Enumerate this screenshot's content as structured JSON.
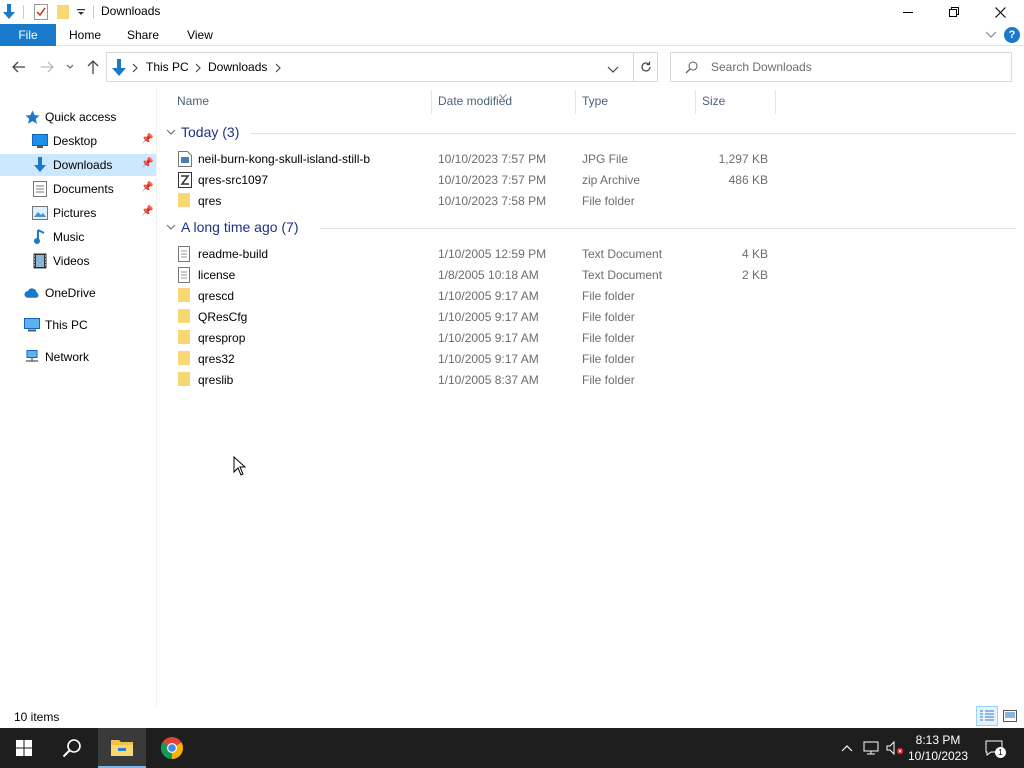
{
  "window": {
    "title": "Downloads",
    "controls": {
      "minimize": "minimize",
      "restore": "restore",
      "close": "close"
    }
  },
  "ribbon": {
    "tabs": [
      "File",
      "Home",
      "Share",
      "View"
    ],
    "help": "?"
  },
  "address": {
    "crumbs": [
      "This PC",
      "Downloads"
    ],
    "search_placeholder": "Search Downloads"
  },
  "navpane": {
    "items": [
      {
        "label": "Quick access",
        "icon": "star-icon"
      },
      {
        "label": "Desktop",
        "icon": "desktop-icon",
        "pinned": true
      },
      {
        "label": "Downloads",
        "icon": "download-icon",
        "pinned": true,
        "selected": true
      },
      {
        "label": "Documents",
        "icon": "documents-icon",
        "pinned": true
      },
      {
        "label": "Pictures",
        "icon": "pictures-icon",
        "pinned": true
      },
      {
        "label": "Music",
        "icon": "music-icon"
      },
      {
        "label": "Videos",
        "icon": "videos-icon"
      },
      {
        "label": "OneDrive",
        "icon": "cloud-icon"
      },
      {
        "label": "This PC",
        "icon": "computer-icon"
      },
      {
        "label": "Network",
        "icon": "network-icon"
      }
    ]
  },
  "columns": {
    "name": "Name",
    "date": "Date modified",
    "type": "Type",
    "size": "Size"
  },
  "groups": [
    {
      "label": "Today (3)",
      "files": [
        {
          "name": "neil-burn-kong-skull-island-still-b",
          "date": "10/10/2023 7:57 PM",
          "type": "JPG File",
          "size": "1,297 KB",
          "icon": "image-file-icon"
        },
        {
          "name": "qres-src1097",
          "date": "10/10/2023 7:57 PM",
          "type": "zip Archive",
          "size": "486 KB",
          "icon": "zip-file-icon"
        },
        {
          "name": "qres",
          "date": "10/10/2023 7:58 PM",
          "type": "File folder",
          "size": "",
          "icon": "folder-icon"
        }
      ]
    },
    {
      "label": "A long time ago (7)",
      "files": [
        {
          "name": "readme-build",
          "date": "1/10/2005 12:59 PM",
          "type": "Text Document",
          "size": "4 KB",
          "icon": "text-file-icon"
        },
        {
          "name": "license",
          "date": "1/8/2005 10:18 AM",
          "type": "Text Document",
          "size": "2 KB",
          "icon": "text-file-icon"
        },
        {
          "name": "qrescd",
          "date": "1/10/2005 9:17 AM",
          "type": "File folder",
          "size": "",
          "icon": "folder-icon"
        },
        {
          "name": "QResCfg",
          "date": "1/10/2005 9:17 AM",
          "type": "File folder",
          "size": "",
          "icon": "folder-icon"
        },
        {
          "name": "qresprop",
          "date": "1/10/2005 9:17 AM",
          "type": "File folder",
          "size": "",
          "icon": "folder-icon"
        },
        {
          "name": "qres32",
          "date": "1/10/2005 9:17 AM",
          "type": "File folder",
          "size": "",
          "icon": "folder-icon"
        },
        {
          "name": "qreslib",
          "date": "1/10/2005 8:37 AM",
          "type": "File folder",
          "size": "",
          "icon": "folder-icon"
        }
      ]
    }
  ],
  "status": {
    "count": "10 items"
  },
  "taskbar": {
    "time": "8:13 PM",
    "date": "10/10/2023"
  },
  "colors": {
    "accent": "#1979ca",
    "selection": "#cce8ff",
    "group_text": "#1e3287",
    "folder": "#f8d775",
    "taskbar": "#1e1e1e"
  }
}
